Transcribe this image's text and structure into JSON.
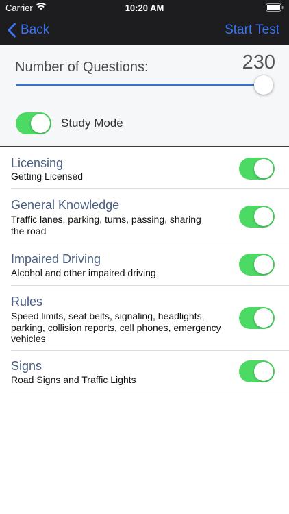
{
  "status_bar": {
    "carrier": "Carrier",
    "time": "10:20 AM"
  },
  "nav": {
    "back_label": "Back",
    "start_label": "Start Test"
  },
  "settings": {
    "questions_label": "Number of Questions:",
    "questions_count": "230",
    "slider_fraction": 1.0,
    "study_mode_label": "Study Mode",
    "study_mode_on": true
  },
  "categories": [
    {
      "title": "Licensing",
      "subtitle": "Getting Licensed",
      "enabled": true
    },
    {
      "title": "General Knowledge",
      "subtitle": "Traffic lanes, parking, turns, passing, sharing the road",
      "enabled": true
    },
    {
      "title": "Impaired Driving",
      "subtitle": "Alcohol and other impaired driving",
      "enabled": true
    },
    {
      "title": "Rules",
      "subtitle": "Speed limits, seat belts, signaling, headlights, parking, collision reports, cell phones, emergency vehicles",
      "enabled": true
    },
    {
      "title": "Signs",
      "subtitle": "Road Signs and Traffic Lights",
      "enabled": true
    }
  ],
  "colors": {
    "accent": "#3b73f5",
    "toggle_on": "#4cd964",
    "category_title": "#4b5f82",
    "top_bar": "#1d1d1f"
  }
}
